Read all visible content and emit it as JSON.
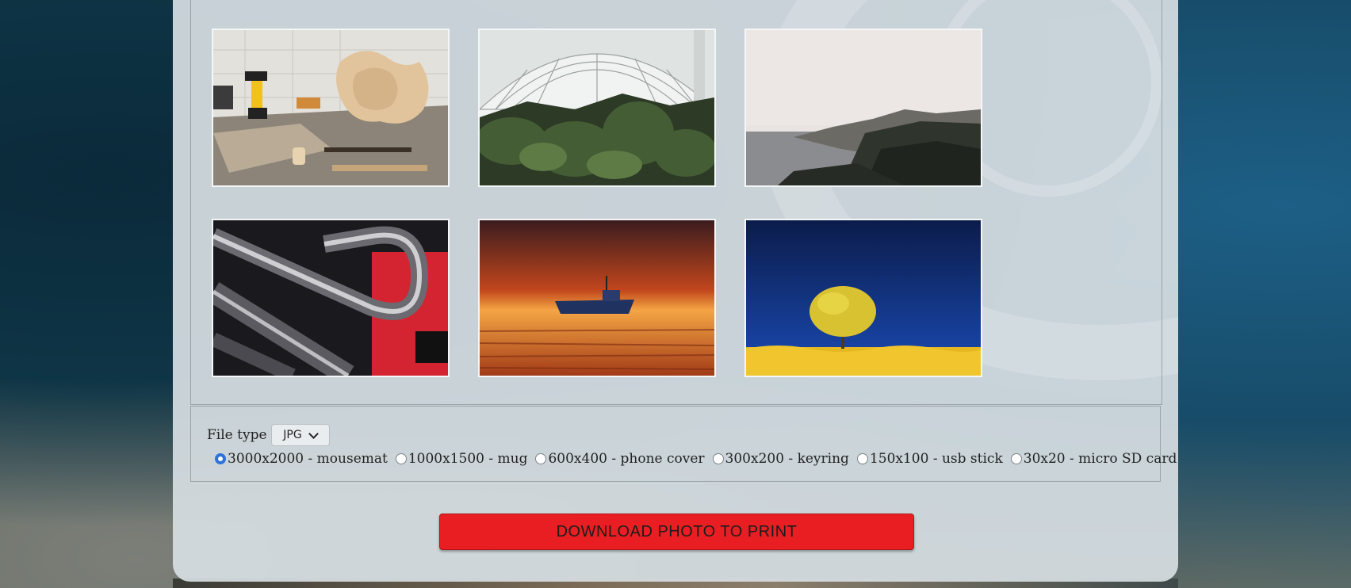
{
  "gallery": {
    "photos": [
      {
        "subject": "woodworking workshop with drill and guitar bodies"
      },
      {
        "subject": "glass greenhouse with palm plants"
      },
      {
        "subject": "misty rocky coastline"
      },
      {
        "subject": "abstract chrome shapes with red light"
      },
      {
        "subject": "boat on beach at sunset"
      },
      {
        "subject": "yellow tree in yellow field under blue sky"
      }
    ]
  },
  "controls": {
    "file_type_label": "File type",
    "file_type_value": "JPG",
    "sizes": [
      {
        "label": "3000x2000 - mousemat",
        "selected": true
      },
      {
        "label": "1000x1500 - mug",
        "selected": false
      },
      {
        "label": "600x400 - phone cover",
        "selected": false
      },
      {
        "label": "300x200 - keyring",
        "selected": false
      },
      {
        "label": "150x100 - usb stick",
        "selected": false
      },
      {
        "label": "30x20 - micro SD card",
        "selected": false
      }
    ]
  },
  "download_button": {
    "label": "DOWNLOAD PHOTO TO PRINT",
    "color": "#e81e22"
  }
}
